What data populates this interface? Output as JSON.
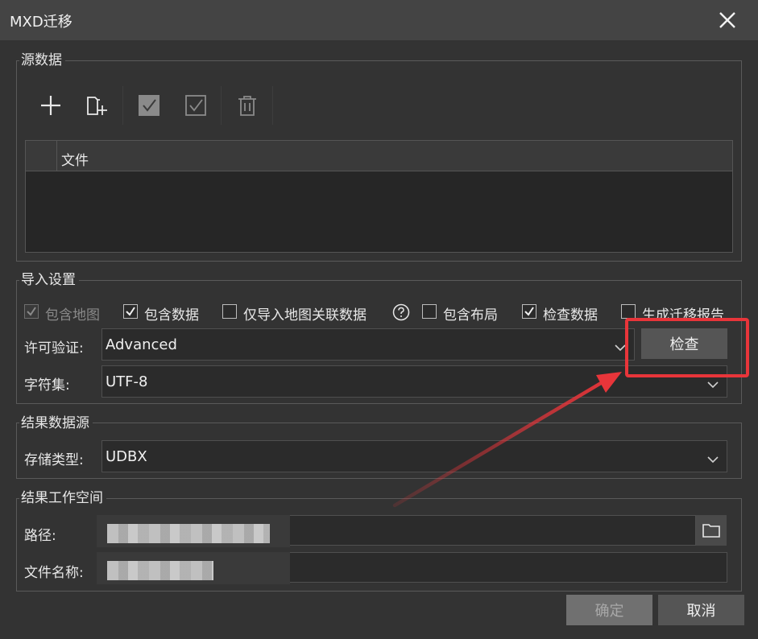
{
  "window": {
    "title": "MXD迁移",
    "close_icon": "close-icon"
  },
  "source": {
    "legend": "源数据",
    "toolbar": [
      "add-icon",
      "add-folder-icon",
      "select-all-icon",
      "invert-select-icon",
      "delete-icon"
    ],
    "table": {
      "columns": [
        "",
        "文件"
      ],
      "rows": []
    }
  },
  "import_settings": {
    "legend": "导入设置",
    "options": [
      {
        "label": "包含地图",
        "checked": true,
        "disabled": true
      },
      {
        "label": "包含数据",
        "checked": true,
        "disabled": false
      },
      {
        "label": "仅导入地图关联数据",
        "checked": false,
        "disabled": false
      },
      {
        "label": "包含布局",
        "checked": false,
        "disabled": false
      },
      {
        "label": "检查数据",
        "checked": true,
        "disabled": false
      },
      {
        "label": "生成迁移报告",
        "checked": false,
        "disabled": false
      }
    ],
    "help_icon": "question-circle-icon",
    "license_label": "许可验证:",
    "license_value": "Advanced",
    "check_button": "检查",
    "charset_label": "字符集:",
    "charset_value": "UTF-8"
  },
  "result_datasource": {
    "legend": "结果数据源",
    "storage_label": "存储类型:",
    "storage_value": "UDBX"
  },
  "result_workspace": {
    "legend": "结果工作空间",
    "path_label": "路径:",
    "filename_label": "文件名称:",
    "browse_icon": "folder-icon"
  },
  "footer": {
    "ok_label": "确定",
    "cancel_label": "取消"
  },
  "annotation": {
    "highlight_color": "#e8353a"
  }
}
